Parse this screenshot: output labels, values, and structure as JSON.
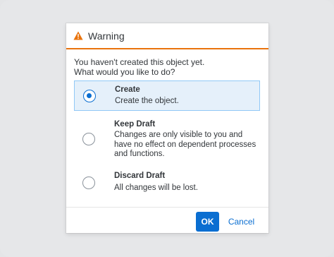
{
  "dialog": {
    "title": "Warning",
    "icon": "warning-icon",
    "message_line1": "You haven't created this object yet.",
    "message_line2": "What would you like to do?",
    "options": [
      {
        "label": "Create",
        "description_lines": [
          "Create the object."
        ],
        "selected": true
      },
      {
        "label": "Keep Draft",
        "description_lines": [
          "Changes are only visible to you and",
          "have no effect on dependent processes",
          "and functions."
        ],
        "selected": false
      },
      {
        "label": "Discard Draft",
        "description_lines": [
          "All changes will be lost."
        ],
        "selected": false
      }
    ],
    "buttons": {
      "ok": "OK",
      "cancel": "Cancel"
    }
  },
  "colors": {
    "accent": "#0a6ed1",
    "warning": "#e9730c",
    "selected_bg": "#e5f0fa"
  }
}
